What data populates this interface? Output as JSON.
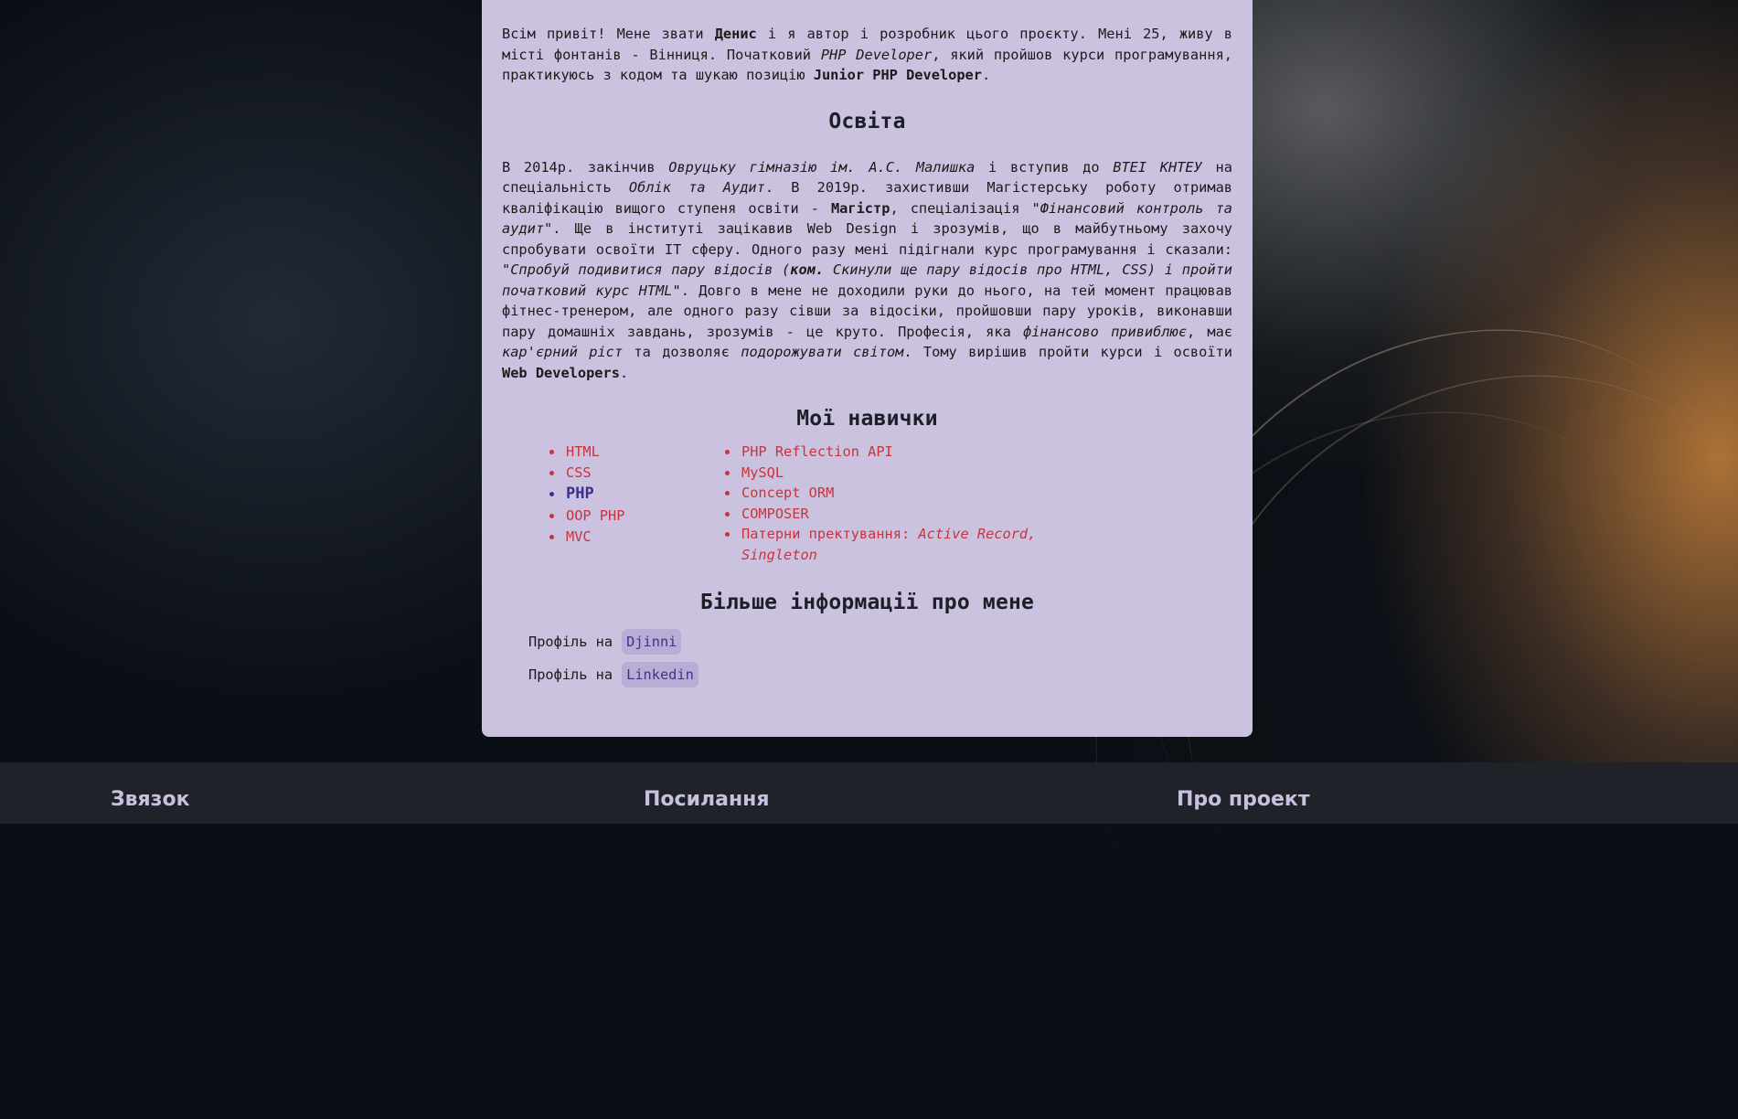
{
  "intro": {
    "p1": "Всім привіт! Мене звати ",
    "name": "Денис",
    "p2": " і я автор і розробник цього проєкту. Мені 25, живу в місті фонтанів - Вінниця. Початковий ",
    "role_italic": "PHP Developer",
    "p3": ", який пройшов курси програмування, практикуюсь з кодом та шукаю позицію ",
    "position": "Junior PHP Developer",
    "p4": "."
  },
  "education": {
    "title": "Освіта",
    "t1": "В 2014р. закінчив ",
    "i1": "Овруцьку гімназію ім. А.С. Малишка",
    "t2": " і вступив до ",
    "i2": "ВТЕІ КНТЕУ",
    "t3": " на спеціальність ",
    "i3": "Облік та Аудит",
    "t4": ". В 2019р. захистивши Магістерську роботу отримав кваліфікацію вищого ступеня освіти - ",
    "b1": "Магістр",
    "t5": ", спеціалізація ",
    "i4": "\"Фінансовий контроль та аудит\"",
    "t6": ". Ще в інституті зацікавив Web Design і зрозумів, що в майбутньому захочу спробувати освоїти IT сферу. Одного разу мені підігнали курс програмування і сказали: ",
    "i5": "\"Спробуй подивитися пару відосів (",
    "b2": "ком.",
    "i6": " Скинули ще пару відосів про HTML, CSS) і пройти початковий курс HTML\"",
    "t7": ". Довго в мене не доходили руки до нього, на тей момент працював фітнес-тренером, але одного разу сівши за відосіки, пройшовши пару уроків, виконавши пару домашніх завдань, зрозумів - це круто. Професія, яка ",
    "i7": "фінансово привиблює",
    "t8": ", має ",
    "i8": "кар'єрний ріст",
    "t9": " та дозволяє ",
    "i9": "подорожувати світом",
    "t10": ". Тому вирішив пройти курси і освоїти ",
    "b3": "Web Developers",
    "t11": "."
  },
  "skills": {
    "title": "Мої навички",
    "col1": [
      "HTML",
      "CSS",
      "PHP",
      "OOP PHP",
      "MVC"
    ],
    "col2": [
      "PHP Reflection API",
      "MySQL",
      "Concept ORM",
      "COMPOSER"
    ],
    "patterns_label": "Патерни пректування: ",
    "patterns_value": "Active Record, Singleton"
  },
  "more": {
    "title": "Більше інформації про мене",
    "profile_label": "Профіль на",
    "links": [
      "Djinni",
      "Linkedin"
    ]
  },
  "footer": {
    "contact": "Звязок",
    "links": "Посилання",
    "about": "Про проект"
  },
  "colors": {
    "card": "#cbc2e0",
    "skill_link": "#c8343e",
    "active_skill": "#3b2f8f",
    "footer": "#1f2329",
    "footer_heading": "#c7c1df"
  }
}
